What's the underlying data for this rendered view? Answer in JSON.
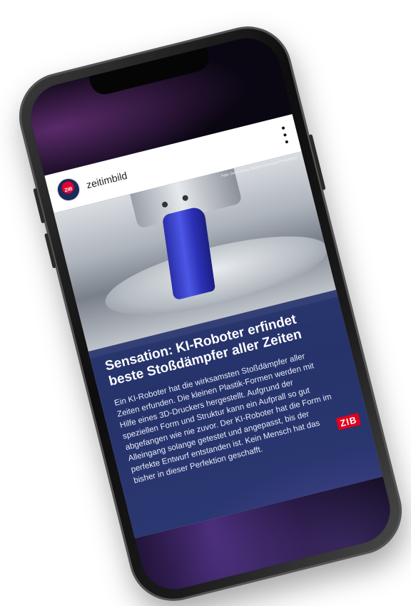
{
  "post": {
    "username": "zeitimbild",
    "avatar_label": "ZIB",
    "photo_credit": "Foto: Devin Heinz, Boston University Productions",
    "headline": "Sensation: KI-Roboter erfindet beste Stoßdämpfer aller Zeiten",
    "body": "Ein KI-Roboter hat die wirksamsten Stoßdämpfer aller Zeiten erfunden. Die kleinen Plastik-Formen werden mit Hilfe eines 3D-Druckers hergestellt. Aufgrund der speziellen Form und Struktur kann ein Aufprall so gut abgefangen wie nie zuvor. Der KI-Roboter hat die Form im Alleingang solange getestet und angepasst, bis der perfekte Entwurf entstanden ist. Kein Mensch hat das bisher in dieser Perfektion geschafft.",
    "logo_text": "ZIB"
  },
  "icons": {
    "more": "more-vertical-icon"
  },
  "colors": {
    "panel": "#26336b",
    "logo": "#e3001b",
    "object": "#3a44d0"
  }
}
